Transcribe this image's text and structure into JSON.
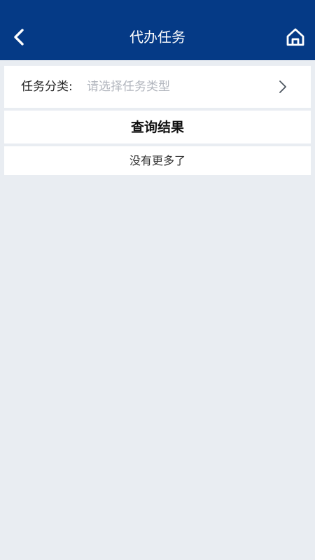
{
  "header": {
    "title": "代办任务",
    "back_icon": "back-chevron-icon",
    "home_icon": "home-icon"
  },
  "filter": {
    "label": "任务分类:",
    "placeholder": "请选择任务类型",
    "chevron_icon": "chevron-right-icon"
  },
  "results": {
    "title": "查询结果",
    "empty_text": "没有更多了"
  },
  "colors": {
    "header_background": "#053a86",
    "page_background": "#e9edf2",
    "card_background": "#ffffff",
    "placeholder": "#b1b5bd"
  }
}
